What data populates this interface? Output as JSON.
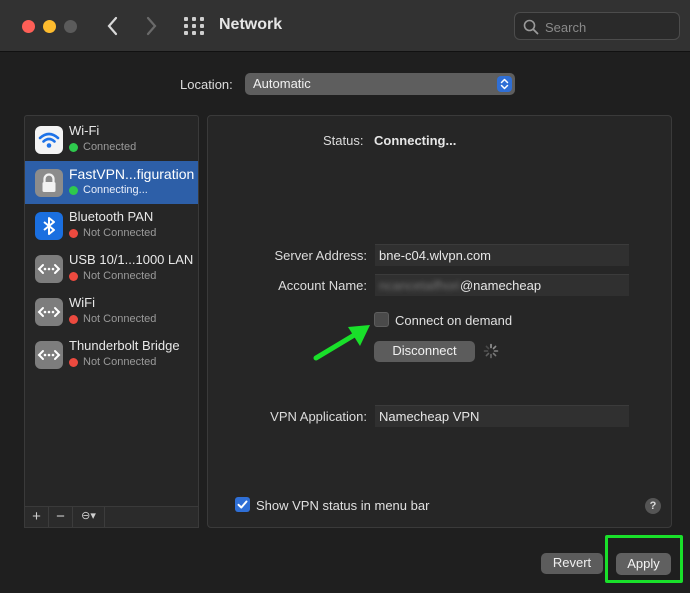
{
  "window": {
    "title": "Network"
  },
  "search": {
    "placeholder": "Search"
  },
  "location": {
    "label": "Location:",
    "value": "Automatic"
  },
  "services": [
    {
      "name": "Wi-Fi",
      "status": "Connected",
      "status_color": "#2ec94d",
      "icon": "wifi-icon"
    },
    {
      "name": "FastVPN...figuration",
      "status": "Connecting...",
      "status_color": "#2ec94d",
      "icon": "lock-icon"
    },
    {
      "name": "Bluetooth PAN",
      "status": "Not Connected",
      "status_color": "#ec4a3f",
      "icon": "bluetooth-icon"
    },
    {
      "name": "USB 10/1...1000 LAN",
      "status": "Not Connected",
      "status_color": "#ec4a3f",
      "icon": "ethernet-icon"
    },
    {
      "name": "WiFi",
      "status": "Not Connected",
      "status_color": "#ec4a3f",
      "icon": "ethernet-icon"
    },
    {
      "name": "Thunderbolt Bridge",
      "status": "Not Connected",
      "status_color": "#ec4a3f",
      "icon": "ethernet-icon"
    }
  ],
  "sidebar_toolbar": {
    "add": "+",
    "remove": "−",
    "action": "⊖▾"
  },
  "detail": {
    "status_label": "Status:",
    "status_value": "Connecting...",
    "server_label": "Server Address:",
    "server_value": "bne-c04.wlvpn.com",
    "account_label": "Account Name:",
    "account_hidden": "ncancetaifhori",
    "account_suffix": "@namecheap",
    "connect_on_demand": "Connect on demand",
    "disconnect": "Disconnect",
    "vpn_app_label": "VPN Application:",
    "vpn_app_value": "Namecheap VPN",
    "show_status": "Show VPN status in menu bar",
    "help": "?"
  },
  "buttons": {
    "revert": "Revert",
    "apply": "Apply"
  },
  "colors": {
    "accent": "#2f6fd6",
    "highlight": "#19e02a",
    "selected": "#2d5fa8"
  }
}
